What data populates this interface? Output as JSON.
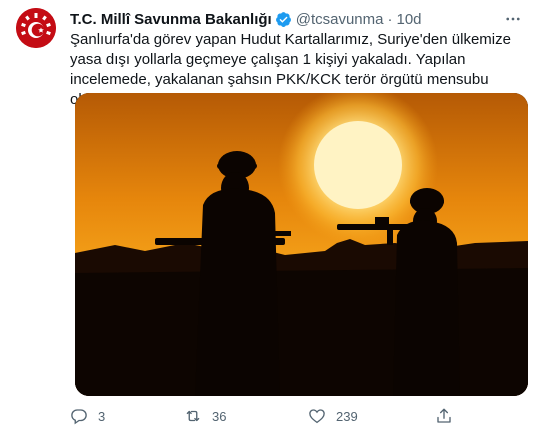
{
  "account": {
    "display_name": "T.C. Millî Savunma Bakanlığı",
    "handle": "@tcsavunma",
    "separator": "·",
    "time": "10d",
    "verified_icon": "verified-badge-icon",
    "avatar_color": "#c40c14"
  },
  "tweet": {
    "text": "Şanlıurfa'da görev yapan Hudut Kartallarımız, Suriye'den ülkemize yasa dışı yollarla geçmeye çalışan 1 kişiyi yakaladı. Yapılan incelemede, yakalanan şahsın PKK/KCK terör örgütü mensubu olduğu belirlendi."
  },
  "actions": {
    "reply_count": "3",
    "retweet_count": "36",
    "like_count": "239"
  },
  "colors": {
    "accent": "#1d9bf0",
    "muted": "#536471",
    "sunset_orange": "#f08a0a",
    "sun": "#fff4c0"
  }
}
